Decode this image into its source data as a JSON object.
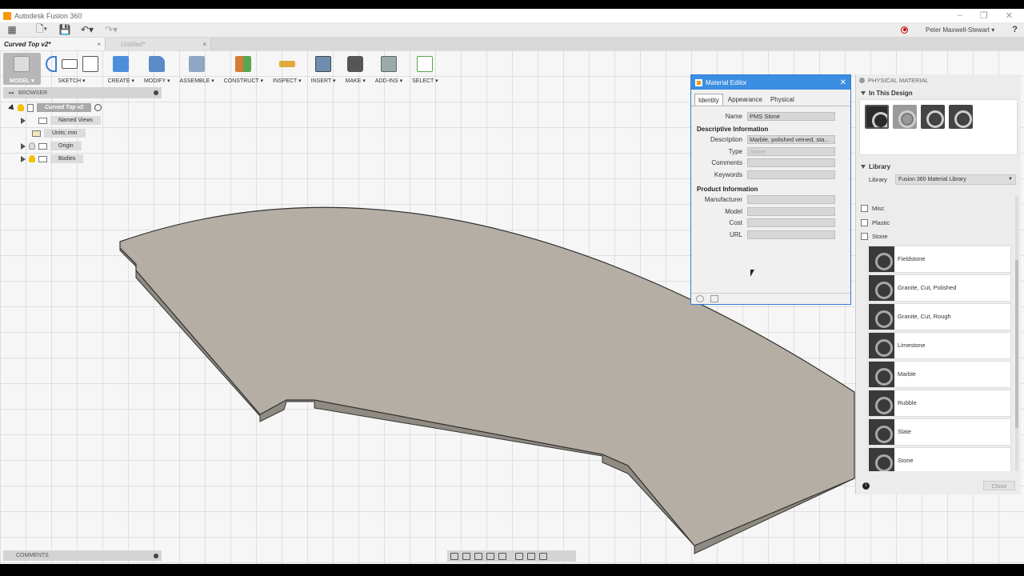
{
  "window": {
    "title": "Autodesk Fusion 360"
  },
  "quick_access": {
    "user_name": "Peter Maxwell-Stewart ▾",
    "help": "?"
  },
  "doc_tabs": [
    {
      "label": "Curved Top v2*",
      "close": "×"
    },
    {
      "label": "Untitled*",
      "close": "×"
    }
  ],
  "toolbar": {
    "model": "MODEL ▾",
    "sketch": "SKETCH ▾",
    "create": "CREATE ▾",
    "modify": "MODIFY ▾",
    "assemble": "ASSEMBLE ▾",
    "construct": "CONSTRUCT ▾",
    "inspect": "INSPECT ▾",
    "insert": "INSERT ▾",
    "make": "MAKE ▾",
    "addins": "ADD-INS ▾",
    "select": "SELECT ▾"
  },
  "browser": {
    "title": "BROWSER",
    "root": "Curved Top v2",
    "items": [
      "Named Views",
      "Units: mm",
      "Origin",
      "Bodies"
    ]
  },
  "comments": {
    "title": "COMMENTS"
  },
  "material_editor": {
    "title": "Material Editor",
    "tabs": [
      "Identity",
      "Appearance",
      "Physical"
    ],
    "name_label": "Name",
    "name_value": "PMS Stone",
    "descriptive_header": "Descriptive Information",
    "description_label": "Description",
    "description_value": "Marble, polished veined, sta...",
    "type_label": "Type",
    "type_value": "Stone",
    "comments_label": "Comments",
    "keywords_label": "Keywords",
    "product_header": "Product Information",
    "manufacturer_label": "Manufacturer",
    "model_label": "Model",
    "cost_label": "Cost",
    "url_label": "URL"
  },
  "physical_material": {
    "title": "PHYSICAL MATERIAL",
    "in_this_design": "In This Design",
    "library_header": "Library",
    "library_label": "Library",
    "library_value": "Fusion 360 Material Library",
    "categories": [
      "Misc",
      "Plastic",
      "Stone"
    ],
    "materials": [
      "Fieldstone",
      "Granite, Cut, Polished",
      "Granite, Cut, Rough",
      "Limestone",
      "Marble",
      "Rubble",
      "Slate",
      "Stone"
    ],
    "close": "Close"
  },
  "colors": {
    "accent": "#3b8ee1",
    "model_top": "#b5aea4",
    "model_side": "#8f8a82"
  }
}
